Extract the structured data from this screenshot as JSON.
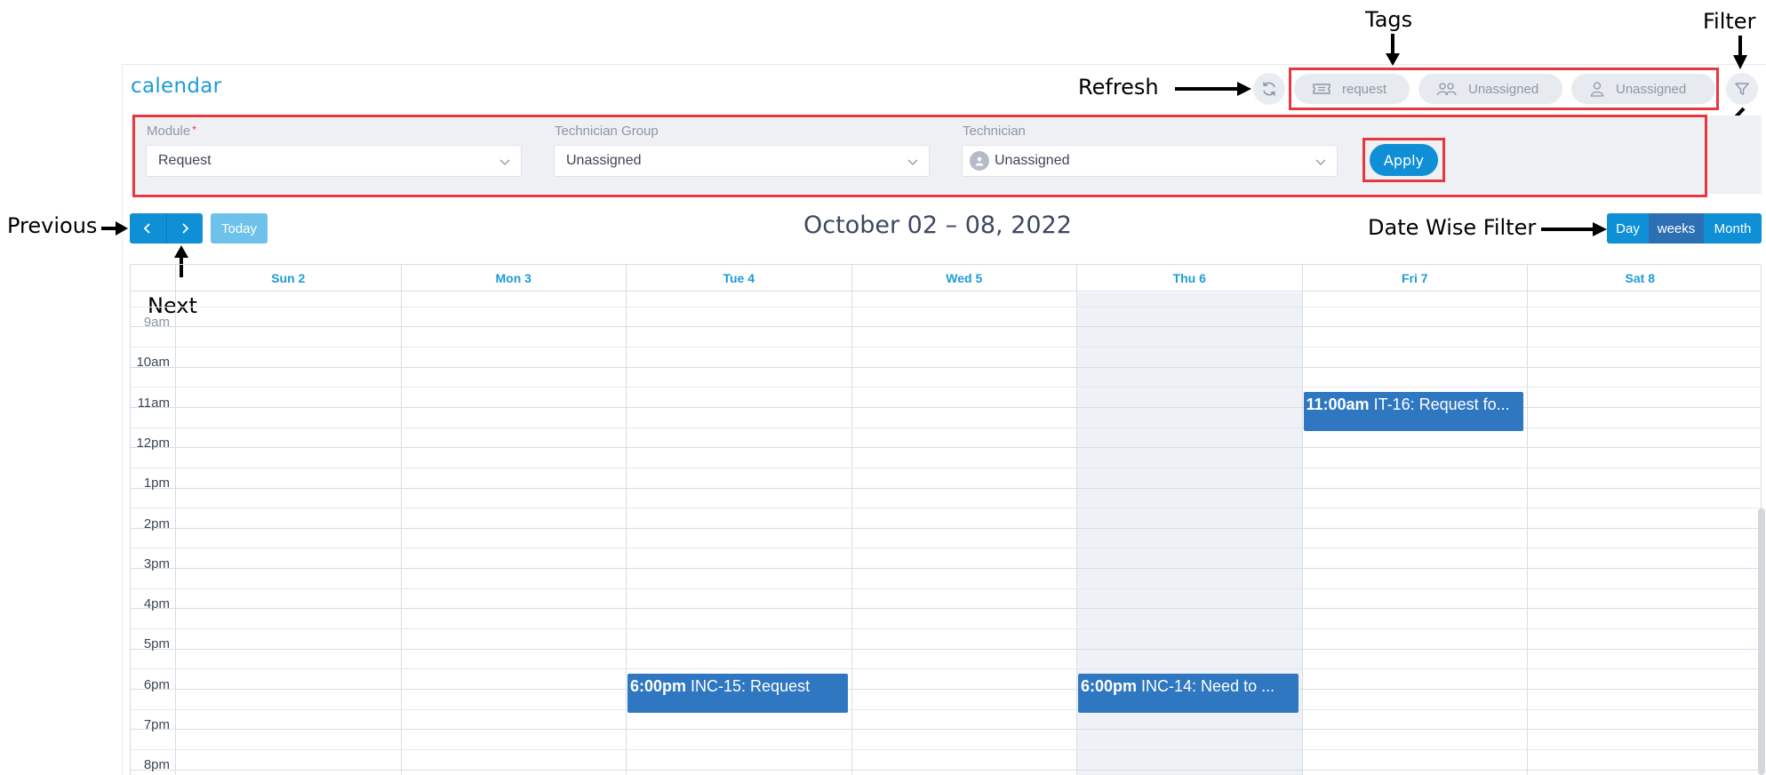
{
  "app": {
    "title": "calendar"
  },
  "toolbar": {
    "refresh_annotation": "Refresh",
    "tags_annotation": "Tags",
    "filter_annotation": "Filter",
    "tags": [
      {
        "label": "request",
        "icon": "ticket-icon"
      },
      {
        "label": "Unassigned",
        "icon": "group-icon"
      },
      {
        "label": "Unassigned",
        "icon": "user-icon"
      }
    ]
  },
  "filters": {
    "module": {
      "label": "Module",
      "required_mark": "*",
      "value": "Request"
    },
    "technician_group": {
      "label": "Technician Group",
      "value": "Unassigned"
    },
    "technician": {
      "label": "Technician",
      "value": "Unassigned"
    },
    "apply_label": "Apply"
  },
  "navigation": {
    "previous_annotation": "Previous",
    "next_annotation": "Next",
    "today_label": "Today",
    "date_range": "October 02 – 08, 2022",
    "date_filter_annotation": "Date Wise Filter",
    "views": [
      {
        "label": "Day",
        "active": false
      },
      {
        "label": "weeks",
        "active": true
      },
      {
        "label": "Month",
        "active": false
      }
    ]
  },
  "calendar": {
    "days": [
      "Sun 2",
      "Mon 3",
      "Tue 4",
      "Wed 5",
      "Thu 6",
      "Fri 7",
      "Sat 8"
    ],
    "today_index": 4,
    "hours": [
      "9am",
      "10am",
      "11am",
      "12pm",
      "1pm",
      "2pm",
      "3pm",
      "4pm",
      "5pm",
      "6pm",
      "7pm",
      "8pm"
    ],
    "events": [
      {
        "time": "11:00am",
        "title": "IT-16: Request fo...",
        "day_index": 5,
        "hour": "11am"
      },
      {
        "time": "6:00pm",
        "title": "INC-15: Request",
        "day_index": 2,
        "hour": "6pm"
      },
      {
        "time": "6:00pm",
        "title": "INC-14: Need to ...",
        "day_index": 4,
        "hour": "6pm"
      }
    ]
  },
  "colors": {
    "accent": "#1d9bd8",
    "primary_button": "#0f8fd6",
    "event": "#2f77c1",
    "annotation_box": "#e8383f"
  }
}
